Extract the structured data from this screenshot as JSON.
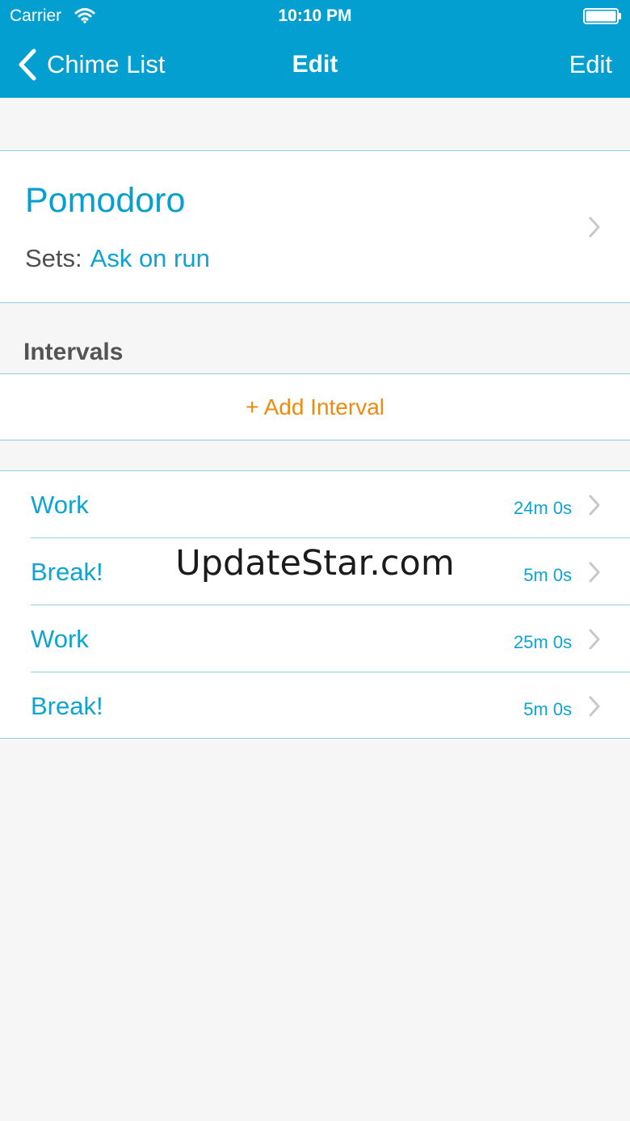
{
  "status_bar": {
    "carrier": "Carrier",
    "time": "10:10 PM",
    "icons": [
      "wifi-icon",
      "battery-icon"
    ]
  },
  "nav": {
    "back_label": "Chime List",
    "title": "Edit",
    "edit_label": "Edit",
    "icons": [
      "chevron-left-icon"
    ]
  },
  "timer": {
    "name": "Pomodoro",
    "sets_label": "Sets:",
    "sets_value": "Ask on run"
  },
  "intervals": {
    "header": "Intervals",
    "add_label": "+ Add Interval",
    "items": [
      {
        "name": "Work",
        "duration": "24m 0s"
      },
      {
        "name": "Break!",
        "duration": "5m 0s"
      },
      {
        "name": "Work",
        "duration": "25m 0s"
      },
      {
        "name": "Break!",
        "duration": "5m 0s"
      }
    ]
  },
  "watermark": "UpdateStar.com",
  "colors": {
    "header_bg": "#049fd1",
    "accent": "#0fa3cf",
    "add_action": "#ee8a0f",
    "background": "#f6f6f6",
    "separator": "#8fd0df"
  }
}
